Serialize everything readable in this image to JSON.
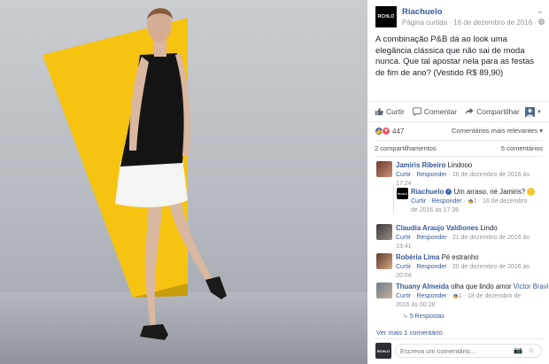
{
  "page": {
    "name": "Riachuelo",
    "logo_text": "RCHLO",
    "meta": "Página curtida · 16 de dezembro de 2016 · ",
    "caption": "A combinação P&B dá ao look uma elegância clássica que não sai de moda nunca. Que tal apostar nela para as festas de fim de ano? (Vestido R$ 89,90)"
  },
  "actions": {
    "like": "Curtir",
    "comment": "Comentar",
    "share": "Compartilhar"
  },
  "reactions": {
    "count": "447",
    "sort": "Comentários mais relevantes"
  },
  "stats": {
    "shares": "2 compartilhamentos",
    "comments": "5 comentários"
  },
  "comments": [
    {
      "name": "Jamiris Ribeiro",
      "text": "Lindooo",
      "like": "Curtir",
      "reply": "Responder",
      "time_line1": "16 de dezembro de 2016 às",
      "time_line2": "17:24"
    },
    {
      "name": "Riachuelo",
      "text": "Um arraso, né Jamiris?",
      "like": "Curtir",
      "reply": "Responder",
      "likes": "1",
      "time_line1": "16 de dezembro",
      "time_line2": "de 2016 às 17:36"
    },
    {
      "name": "Claudia Araujo Valdiones",
      "text": "Lindo",
      "like": "Curtir",
      "reply": "Responder",
      "time_line1": "21 de dezembro de 2016 às",
      "time_line2": "13:41"
    },
    {
      "name": "Robéria Lima",
      "text": "Pé estranho",
      "like": "Curtir",
      "reply": "Responder",
      "time_line1": "20 de dezembro de 2016 às",
      "time_line2": "20:04"
    },
    {
      "name": "Thuany Almeida",
      "text": "olha que lindo amor",
      "tag": "Victor Bravi",
      "like": "Curtir",
      "reply": "Responder",
      "likes": "1",
      "time_line1": "18 de dezembro de",
      "time_line2": "2016 às 00:28",
      "replies": "5 Respostas"
    }
  ],
  "more_comments": "Ver mais 1 comentário",
  "compose": {
    "placeholder": "Escreva um comentário..."
  },
  "colors": {
    "accent": "#365899",
    "photo_yellow": "#f6c311",
    "like_blue": "#4267b2",
    "love_red": "#f25268"
  }
}
